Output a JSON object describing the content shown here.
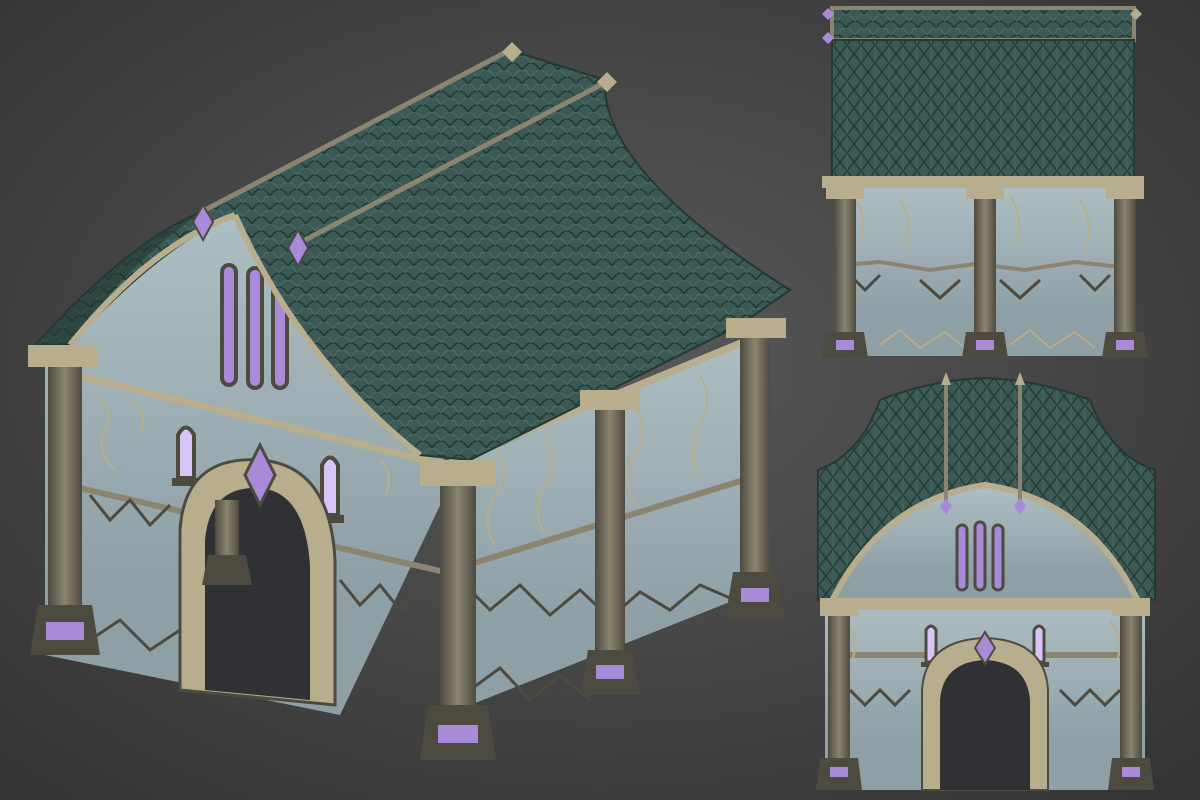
{
  "scene": {
    "subject": "",
    "views": [
      {
        "id": "perspective",
        "label": ""
      },
      {
        "id": "side-elevation",
        "label": ""
      },
      {
        "id": "front-elevation",
        "label": ""
      }
    ]
  },
  "palette": {
    "background_center": "#595959",
    "background_edge": "#323232",
    "wall": "#aebfc3",
    "wall_shadow": "#8e9fa6",
    "roof": "#3b5a55",
    "roof_dark": "#243934",
    "roof_light": "#5f7f79",
    "stone": "#8a8470",
    "stone_dark": "#4d4a40",
    "trim": "#b8ad8d",
    "crystal": "#a98ad8",
    "crystal_glow": "#d7c6f5",
    "doorway": "#2f3134"
  }
}
